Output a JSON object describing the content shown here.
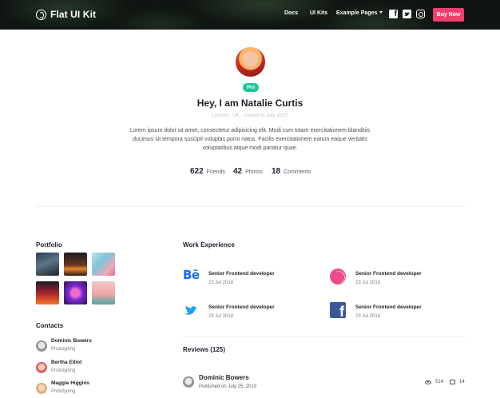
{
  "header": {
    "brand": "Flat UI Kit",
    "nav": [
      {
        "label": "Docs"
      },
      {
        "label": "UI Kits"
      },
      {
        "label": "Example Pages"
      }
    ],
    "social_icons": [
      "facebook-icon",
      "twitter-icon",
      "instagram-icon"
    ],
    "buy_label": "Buy Now",
    "buy_color": "#ef3f6d"
  },
  "profile": {
    "badge": "Pro",
    "badge_color": "#1dc79a",
    "name": "Hey, I am Natalie Curtis",
    "location_line": "London, UK  -  Joined in July 2017",
    "bio": "Lorem ipsum dolor sit amet, consectetur adipisicing elit. Modi cum totam exercitationem blanditiis ducimus sit tempora suscipit voluptas porro natus. Facilis exercitationem earum eaque veritatis voluptatibus atque modi pariatur quae.",
    "stats": [
      {
        "value": "622",
        "label": "Friends"
      },
      {
        "value": "42",
        "label": "Photos"
      },
      {
        "value": "18",
        "label": "Comments"
      }
    ]
  },
  "portfolio": {
    "title": "Portfolio",
    "items": [
      "image",
      "image",
      "image",
      "image",
      "image",
      "image"
    ]
  },
  "contacts": {
    "title": "Contacts",
    "items": [
      {
        "name": "Dominic Bowers",
        "role": "Prototyping"
      },
      {
        "name": "Bertha Elliot",
        "role": "Prototyping"
      },
      {
        "name": "Maggie Higgins",
        "role": "Prototyping"
      }
    ]
  },
  "work": {
    "title": "Work Experience",
    "items": [
      {
        "icon": "behance-icon",
        "title": "Senior Frontend developer",
        "date": "23 Jul 2018"
      },
      {
        "icon": "dribbble-icon",
        "title": "Senior Frontend developer",
        "date": "23 Jul 2018"
      },
      {
        "icon": "twitter-icon",
        "title": "Senior Frontend developer",
        "date": "23 Jul 2018"
      },
      {
        "icon": "facebook-icon",
        "title": "Senior Frontend developer",
        "date": "23 Jul 2018"
      }
    ]
  },
  "reviews": {
    "title": "Reviews (125)",
    "items": [
      {
        "name": "Dominic Bowers",
        "meta": "Published on July 25, 2019",
        "views": "514",
        "comments": "14"
      }
    ]
  }
}
